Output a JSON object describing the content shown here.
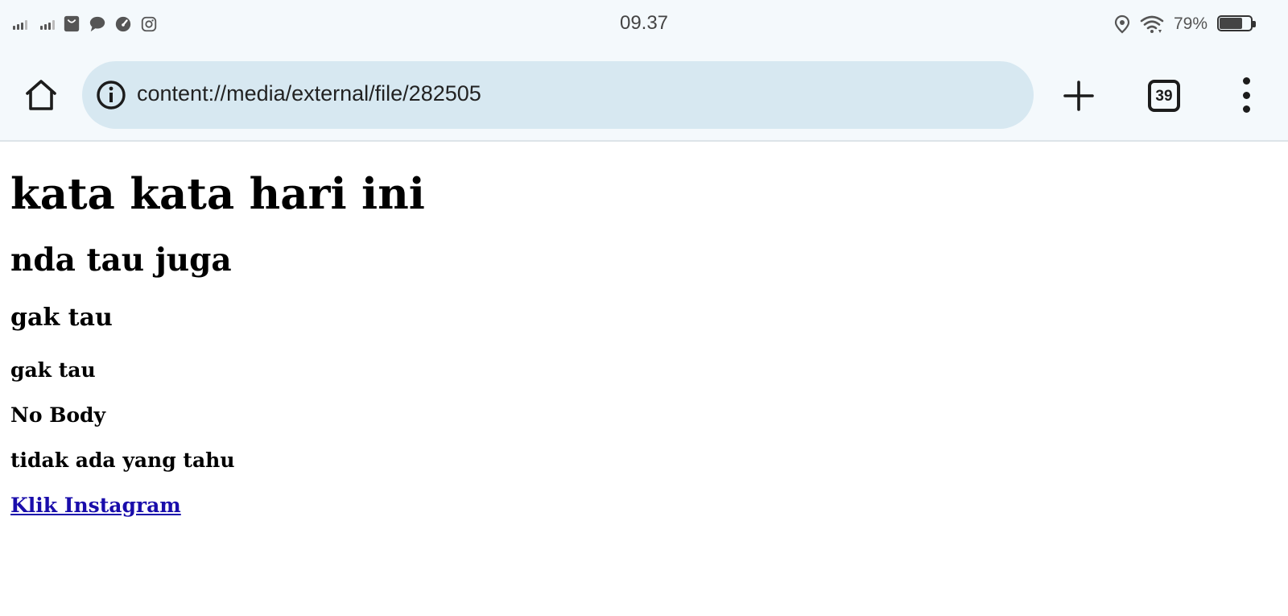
{
  "status_bar": {
    "time": "09.37",
    "battery_percent": "79%",
    "battery_level": 0.79,
    "notification_icons": [
      "signal-1-icon",
      "signal-2-icon",
      "shopping-bag-icon",
      "chat-bubble-icon",
      "speedometer-icon",
      "instagram-icon"
    ],
    "right_icons": [
      "location-icon",
      "wifi-icon",
      "battery-icon"
    ]
  },
  "toolbar": {
    "url": "content://media/external/file/282505",
    "tab_count": "39",
    "icons": {
      "home": "home-icon",
      "site_info": "info-icon",
      "new_tab": "plus-icon",
      "menu": "more-vert-icon"
    }
  },
  "page": {
    "h1": "kata kata hari ini",
    "h2": "nda tau juga",
    "h3": "gak tau",
    "h4": "gak tau",
    "p1": "No Body",
    "p2": "tidak ada yang tahu",
    "link": "Klik Instagram"
  },
  "colors": {
    "chrome_background": "#f4f9fc",
    "omnibox_background": "#d7e8f1",
    "link": "#1a0dab",
    "text": "#000000"
  }
}
